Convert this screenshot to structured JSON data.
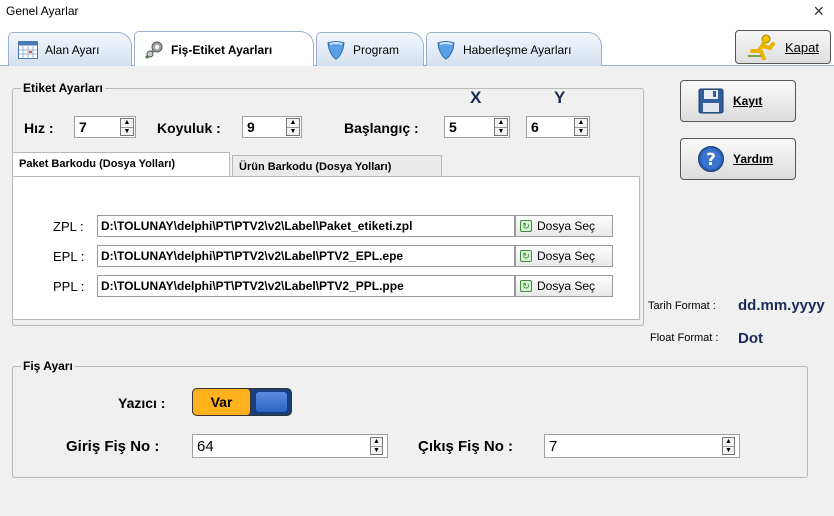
{
  "window": {
    "title": "Genel Ayarlar",
    "close_glyph": "×"
  },
  "tabs": [
    {
      "label": "Alan Ayarı",
      "icon": "calendar-grid-icon"
    },
    {
      "label": "Fiş-Etiket Ayarları",
      "icon": "wrench-gear-icon",
      "active": true
    },
    {
      "label": "Program",
      "icon": "shield-icon"
    },
    {
      "label": "Haberleşme Ayarları",
      "icon": "shield-icon"
    }
  ],
  "kapat_button": {
    "label": "Kapat",
    "icon": "running-man-icon"
  },
  "etiket": {
    "group_title": "Etiket Ayarları",
    "hiz_label": "Hız :",
    "hiz_value": "7",
    "koyuluk_label": "Koyuluk :",
    "koyuluk_value": "9",
    "baslangic_label": "Başlangıç :",
    "x_label": "X",
    "y_label": "Y",
    "x_value": "5",
    "y_value": "6"
  },
  "subtabs": [
    {
      "label": "Paket Barkodu (Dosya Yolları)",
      "active": true
    },
    {
      "label": "Ürün Barkodu (Dosya Yolları)",
      "active": false
    }
  ],
  "paths": [
    {
      "label": "ZPL :",
      "value": "D:\\TOLUNAY\\delphi\\PT\\PTV2\\v2\\Label\\Paket_etiketi.zpl",
      "button": "Dosya Seç"
    },
    {
      "label": "EPL :",
      "value": "D:\\TOLUNAY\\delphi\\PT\\PTV2\\v2\\Label\\PTV2_EPL.epe",
      "button": "Dosya Seç"
    },
    {
      "label": "PPL :",
      "value": "D:\\TOLUNAY\\delphi\\PT\\PTV2\\v2\\Label\\PTV2_PPL.ppe",
      "button": "Dosya Seç"
    }
  ],
  "side_buttons": {
    "kayit": {
      "label": "Kayıt",
      "icon": "floppy-disk-icon"
    },
    "yardim": {
      "label": "Yardım",
      "icon": "help-question-icon"
    }
  },
  "formats": {
    "tarih_label": "Tarih Format :",
    "tarih_value": "dd.mm.yyyy",
    "float_label": "Float Format :",
    "float_value": "Dot"
  },
  "fis": {
    "group_title": "Fiş Ayarı",
    "yazici_label": "Yazıcı :",
    "yazici_value": "Var",
    "giris_label": "Giriş Fiş No :",
    "giris_value": "64",
    "cikis_label": "Çıkış Fiş No :",
    "cikis_value": "7"
  },
  "colors": {
    "accent_orange": "#ffb21d",
    "toggle_blue": "#2d64c4",
    "value_navy": "#1b2b57"
  }
}
